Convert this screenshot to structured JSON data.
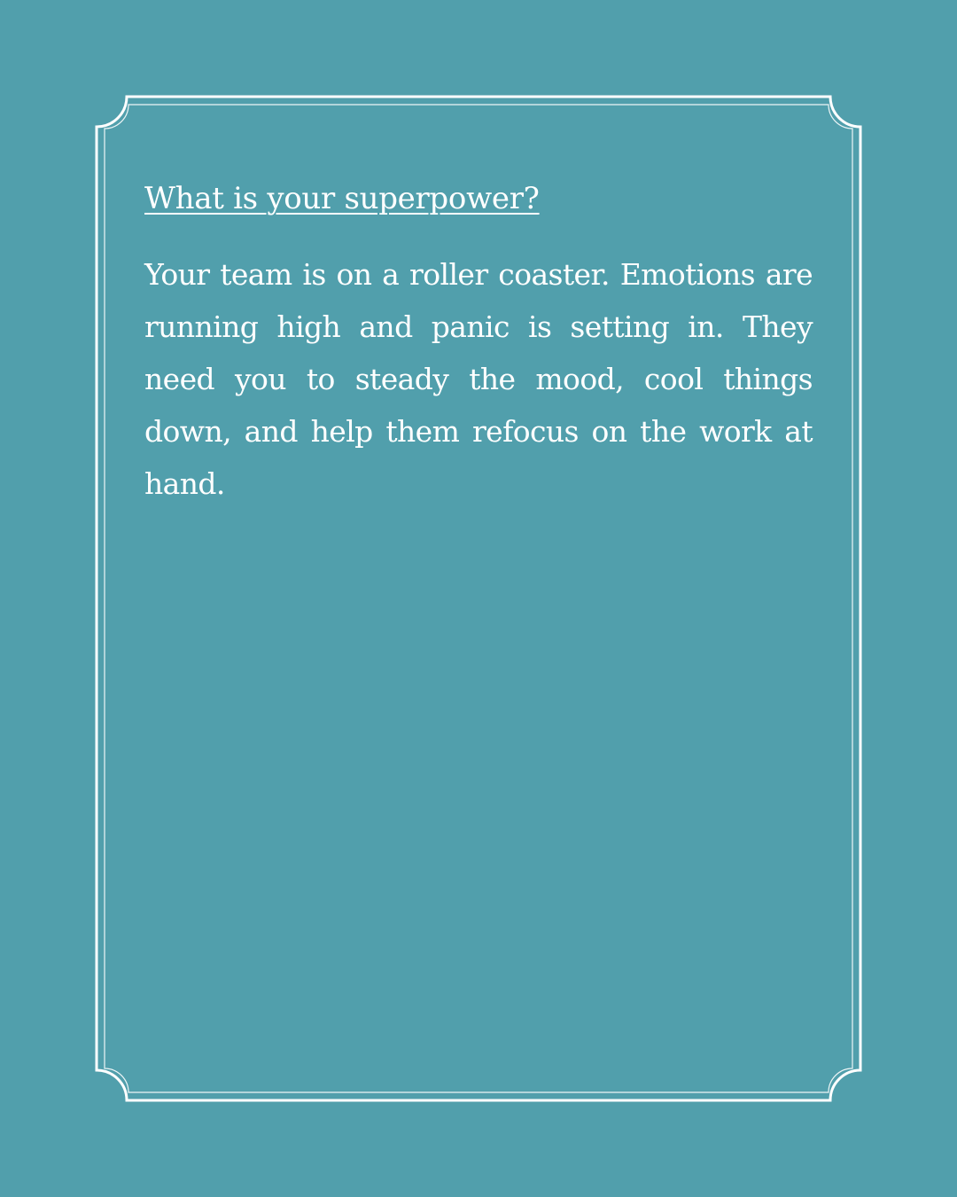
{
  "card": {
    "heading": "What is your superpower?",
    "body": "Your team is on a roller coaster. Emotions are running high and panic is setting in. They need you to steady the mood, cool things down, and help them refocus on the work at hand."
  },
  "colors": {
    "background": "#519FAC",
    "foreground": "#FFFFFF"
  }
}
